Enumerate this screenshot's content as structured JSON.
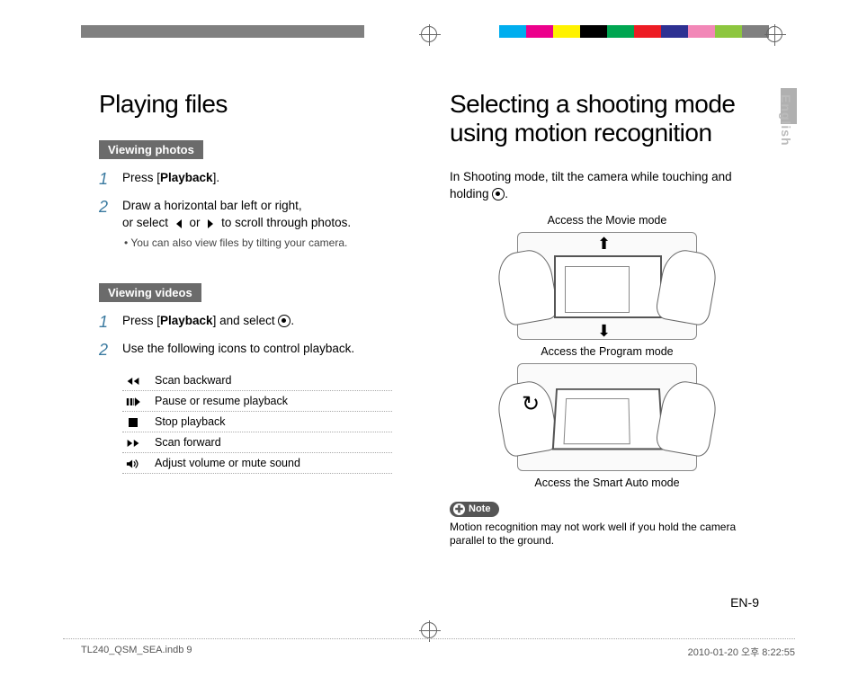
{
  "left": {
    "title": "Playing files",
    "viewing_photos": {
      "tag": "Viewing photos",
      "step1_pre": "Press [",
      "step1_bold": "Playback",
      "step1_post": "].",
      "step2_line1": "Draw a horizontal bar left or right,",
      "step2_line2a": "or select ",
      "step2_line2b": " or ",
      "step2_line2c": " to scroll through photos.",
      "step2_sub": "• You can also view files by tilting your camera."
    },
    "viewing_videos": {
      "tag": "Viewing videos",
      "step1_pre": "Press [",
      "step1_bold": "Playback",
      "step1_post": "] and select ",
      "step1_end": ".",
      "step2": "Use the following icons to control playback.",
      "icons": {
        "scan_backward": "Scan backward",
        "pause_resume": "Pause or resume playback",
        "stop": "Stop playback",
        "scan_forward": "Scan forward",
        "volume": "Adjust volume or mute sound"
      }
    }
  },
  "right": {
    "title": "Selecting a shooting mode using motion recognition",
    "intro_a": "In Shooting mode, tilt the camera while touching and holding ",
    "intro_b": ".",
    "caption_movie": "Access the Movie mode",
    "caption_program": "Access the Program mode",
    "caption_smart": "Access the Smart Auto mode",
    "note_label": "Note",
    "note_text": "Motion recognition may not work well if you hold the camera parallel to the ground."
  },
  "lang_tab": "English",
  "page_num": "EN-9",
  "footer_left": "TL240_QSM_SEA.indb   9",
  "footer_right": "2010-01-20   오후 8:22:55"
}
